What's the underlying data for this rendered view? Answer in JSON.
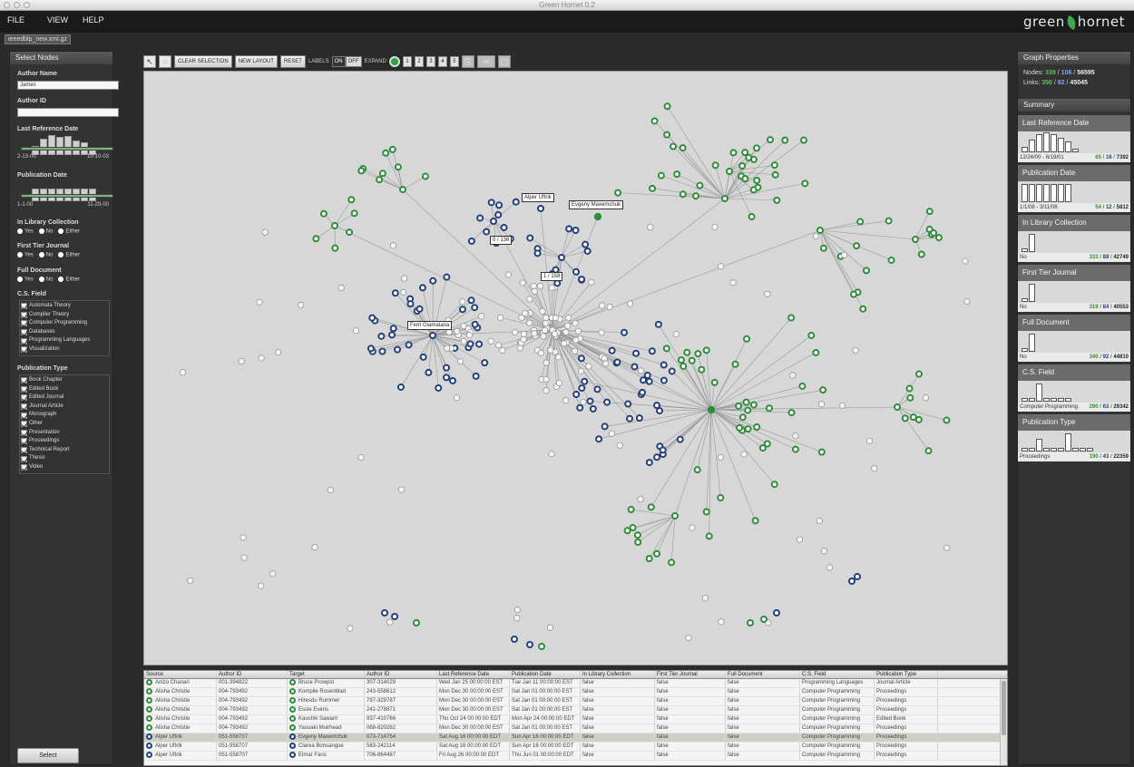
{
  "window": {
    "title": "Green Hornet 0.2",
    "file_tab": "ieeedblp_new.xml.gz"
  },
  "menu": {
    "items": [
      "FILE",
      "VIEW",
      "HELP"
    ],
    "logo_left": "green",
    "logo_right": "hornet"
  },
  "left_panel": {
    "title": "Select Nodes",
    "author_name_label": "Author Name",
    "author_name_value": "James",
    "author_id_label": "Author ID",
    "author_id_value": "",
    "last_ref_label": "Last Reference Date",
    "last_ref_min": "2-13-00",
    "last_ref_max": "10-10-03",
    "pub_date_label": "Publication Date",
    "pub_date_min": "1-1-00",
    "pub_date_max": "11-29-00",
    "in_library_label": "In Library Collection",
    "first_tier_label": "First Tier Journal",
    "full_doc_label": "Full Document",
    "radio_options": [
      "Yes",
      "No",
      "Either"
    ],
    "cs_field_label": "C.S. Field",
    "cs_fields": [
      "Automata Theory",
      "Compiler Theory",
      "Computer Programming",
      "Databases",
      "Programming Languages",
      "Visualization"
    ],
    "pub_type_label": "Publication Type",
    "pub_types": [
      "Book Chapter",
      "Edited Book",
      "Edited Journal",
      "Journal Article",
      "Monograph",
      "Other",
      "Presentation",
      "Proceedings",
      "Technical Report",
      "Thesis",
      "Video"
    ],
    "select_button": "Select"
  },
  "toolbar": {
    "clear_selection": "CLEAR SELECTION",
    "new_layout": "NEW LAYOUT",
    "reset": "RESET",
    "labels": "LABELS",
    "on": "ON",
    "off": "OFF",
    "expand": "EXPAND",
    "expand_levels": [
      "1",
      "2",
      "3",
      "4",
      "5"
    ]
  },
  "graph": {
    "labels": {
      "alper": "Alper Uftrik",
      "evgeny": "Evgeny Maxemchuk",
      "ferri": "Ferri Giamatana",
      "count1": "0 / 136",
      "count2": "1 / 158"
    },
    "colors": {
      "green": "#2f8c3a",
      "blue": "#24407a",
      "grey": "#ffffff",
      "edge": "#9a9a9a",
      "background": "#d7d7d7"
    }
  },
  "table": {
    "headers": [
      "Source",
      "Author ID",
      "Target",
      "Author ID",
      "Last Reference Date",
      "Publication Date",
      "In Library Collection",
      "First Tier Journal",
      "Full Document",
      "C.S. Field",
      "Publication Type"
    ],
    "rows": [
      {
        "src": "Anizo Chanari",
        "src_id": "001-394822",
        "tgt": "Bruce Prowpst",
        "tgt_id": "307-314029",
        "lref": "Wed Jan 25 00:00:00 EST",
        "pdate": "Tue Jan 11 00:00:00 EST",
        "lib": "false",
        "tier": "false",
        "full": "false",
        "field": "Programming Languages",
        "ptype": "Journal Article",
        "selected": false
      },
      {
        "src": "Alisha Christie",
        "src_id": "004-793492",
        "tgt": "Kompile Rosenblad",
        "tgt_id": "243-558612",
        "lref": "Mon Dec 30 00:00:00 EST",
        "pdate": "Sat Jan 01 00:00:00 EST",
        "lib": "false",
        "tier": "false",
        "full": "false",
        "field": "Computer Programming",
        "ptype": "Proceedings",
        "selected": false
      },
      {
        "src": "Alisha Christie",
        "src_id": "004-793492",
        "tgt": "Hiresdu Rummer",
        "tgt_id": "797-329787",
        "lref": "Mon Dec 30 00:00:00 EST",
        "pdate": "Sat Jan 01 00:00:00 EST",
        "lib": "false",
        "tier": "false",
        "full": "false",
        "field": "Computer Programming",
        "ptype": "Proceedings",
        "selected": false
      },
      {
        "src": "Alisha Christie",
        "src_id": "004-793492",
        "tgt": "Essie Everis",
        "tgt_id": "241-278871",
        "lref": "Mon Dec 30 00:00:00 EST",
        "pdate": "Sat Jan 01 00:00:00 EST",
        "lib": "false",
        "tier": "false",
        "full": "false",
        "field": "Computer Programming",
        "ptype": "Proceedings",
        "selected": false
      },
      {
        "src": "Alisha Christie",
        "src_id": "004-793492",
        "tgt": "Kaushik Sawant",
        "tgt_id": "937-410766",
        "lref": "Thu Oct 24 00:00:00 EDT",
        "pdate": "Mon Apr 24 00:00:00 EDT",
        "lib": "false",
        "tier": "false",
        "full": "false",
        "field": "Computer Programming",
        "ptype": "Edited Book",
        "selected": false
      },
      {
        "src": "Alisha Christie",
        "src_id": "004-793492",
        "tgt": "Yasuaki Muirhead",
        "tgt_id": "068-820262",
        "lref": "Mon Dec 30 00:00:00 EST",
        "pdate": "Sat Jan 01 00:00:00 EST",
        "lib": "false",
        "tier": "false",
        "full": "false",
        "field": "Computer Programming",
        "ptype": "Proceedings",
        "selected": false
      },
      {
        "src": "Alper Uftrik",
        "src_id": "051-558707",
        "tgt": "Evgeny Maxemchuk",
        "tgt_id": "073-714754",
        "lref": "Sat Aug 16 00:00:00 EDT",
        "pdate": "Sun Apr 16 00:00:00 EDT",
        "lib": "false",
        "tier": "false",
        "full": "false",
        "field": "Computer Programming",
        "ptype": "Proceedings",
        "selected": true
      },
      {
        "src": "Alper Uftrik",
        "src_id": "051-558707",
        "tgt": "Clarea Bonsangue",
        "tgt_id": "583-242114",
        "lref": "Sat Aug 16 00:00:00 EDT",
        "pdate": "Sun Apr 16 00:00:00 EDT",
        "lib": "false",
        "tier": "false",
        "full": "false",
        "field": "Computer Programming",
        "ptype": "Proceedings",
        "selected": false
      },
      {
        "src": "Alper Uftrik",
        "src_id": "051-558707",
        "tgt": "Elmar Farsi",
        "tgt_id": "706-864487",
        "lref": "Fri Aug 26 00:00:00 EDT",
        "pdate": "Thu Jun 01 00:00:00 EDT",
        "lib": "false",
        "tier": "false",
        "full": "false",
        "field": "Computer Programming",
        "ptype": "Proceedings",
        "selected": false
      }
    ]
  },
  "right_panel": {
    "graph_props_title": "Graph Properties",
    "nodes_label": "Nodes:",
    "nodes_green": "339",
    "nodes_blue": "106",
    "nodes_total": "56595",
    "links_label": "Links:",
    "links_green": "350",
    "links_blue": "92",
    "links_total": "45045",
    "summary_title": "Summary",
    "sections": [
      {
        "title": "Last Reference Date",
        "info": "12/24/00 - 6/19/01",
        "g": "65",
        "b": "16",
        "t": "7392"
      },
      {
        "title": "Publication Date",
        "info": "1/1/08 - 3/11/08",
        "g": "54",
        "b": "12",
        "t": "5812"
      },
      {
        "title": "In Library Collection",
        "info": "No",
        "g": "333",
        "b": "88",
        "t": "42749"
      },
      {
        "title": "First Tier Journal",
        "info": "No",
        "g": "319",
        "b": "84",
        "t": "40553"
      },
      {
        "title": "Full Document",
        "info": "No",
        "g": "340",
        "b": "92",
        "t": "44810"
      },
      {
        "title": "C.S. Field",
        "info": "Computer Programming",
        "g": "290",
        "b": "63",
        "t": "29342"
      },
      {
        "title": "Publication Type",
        "info": "Proceedings",
        "g": "190",
        "b": "43",
        "t": "22359"
      }
    ]
  }
}
